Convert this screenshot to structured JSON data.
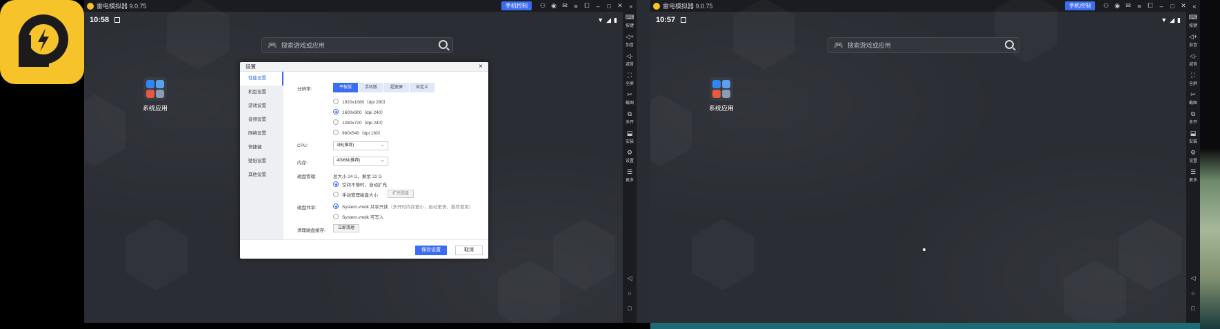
{
  "left": {
    "title": "雷电模拟器 9.0.75",
    "control_btn": "手机控制",
    "time": "10:58",
    "search_placeholder": "搜索游戏或应用",
    "app_label": "系统应用",
    "toolbar": [
      {
        "icon": "keyboard-icon",
        "glyph": "⌨",
        "label": "按键"
      },
      {
        "icon": "volume-up-icon",
        "glyph": "🔊",
        "label": "加音"
      },
      {
        "icon": "volume-down-icon",
        "glyph": "🔉",
        "label": "减音"
      },
      {
        "icon": "fullscreen-icon",
        "glyph": "⛶",
        "label": "全屏"
      },
      {
        "icon": "scissors-icon",
        "glyph": "✂",
        "label": "截图"
      },
      {
        "icon": "multi-open-icon",
        "glyph": "⧉",
        "label": "多开"
      },
      {
        "icon": "install-icon",
        "glyph": "⬓",
        "label": "安装"
      },
      {
        "icon": "settings-icon",
        "glyph": "⚙",
        "label": "设置"
      },
      {
        "icon": "more-icon",
        "glyph": "☰",
        "label": "更多"
      }
    ],
    "dialog": {
      "title": "设置",
      "close": "×",
      "sidebar": [
        "性能设置",
        "机型设置",
        "游戏设置",
        "音频设置",
        "网络设置",
        "快捷键",
        "壁纸设置",
        "其他设置"
      ],
      "resolution_label": "分辨率:",
      "resolution_tabs": [
        "平板版",
        "手机版",
        "超宽屏",
        "自定义"
      ],
      "resolutions": [
        "1920x1080（dpi 280）",
        "1600x900（dpi 240）",
        "1280x720（dpi 240）",
        "960x540（dpi 160）"
      ],
      "cpu_label": "CPU:",
      "cpu_value": "4核(推荐)",
      "memory_label": "内存:",
      "memory_value": "4096M(推荐)",
      "disk_label": "磁盘管理:",
      "disk_info": "总大小 24 G，剩余 22 G",
      "disk_opt1": "空间不够时，自动扩充",
      "disk_opt2": "手动管理磁盘大小",
      "disk_expand_btn": "扩充磁盘",
      "share_label": "磁盘共享:",
      "share_opt1": "System.vmdk 共享只读",
      "share_opt1_note": "（多开时内存更小，启动更快，推荐使用）",
      "share_opt2": "System.vmdk 可写入",
      "cache_label": "清理磁盘缓存:",
      "cache_btn": "立即清理",
      "save_btn": "保存设置",
      "cancel_btn": "取消"
    }
  },
  "right": {
    "title": "雷电模拟器 9.0.75",
    "control_btn": "手机控制",
    "time": "10:57",
    "search_placeholder": "搜索游戏或应用",
    "app_label": "系统应用"
  },
  "nav": {
    "back": "◁",
    "home": "○",
    "recent": "□"
  },
  "colors": {
    "accent": "#3b6cf2",
    "logo": "#f6c32a",
    "bg": "#2b2d34"
  }
}
